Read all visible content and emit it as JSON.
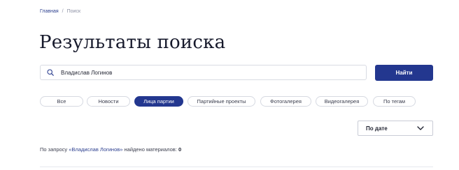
{
  "breadcrumb": {
    "home": "Главная",
    "separator": "/",
    "current": "Поиск"
  },
  "page_title": "Результаты поиска",
  "search": {
    "value": "Владислав Логинов",
    "button_label": "Найти"
  },
  "filters": [
    {
      "label": "Все",
      "active": false
    },
    {
      "label": "Новости",
      "active": false
    },
    {
      "label": "Лица партии",
      "active": true
    },
    {
      "label": "Партийные проекты",
      "active": false
    },
    {
      "label": "Фотогалерея",
      "active": false
    },
    {
      "label": "Видеогалерея",
      "active": false
    },
    {
      "label": "По тегам",
      "active": false
    }
  ],
  "sort": {
    "selected": "По дате"
  },
  "summary": {
    "prefix": "По запросу",
    "query": "«Владислав Логинов»",
    "middle": "найдено материалов:",
    "count": "0"
  },
  "colors": {
    "accent": "#23378f",
    "text": "#1f2230",
    "muted": "#8b8fa3",
    "border": "#d6d9e1"
  }
}
